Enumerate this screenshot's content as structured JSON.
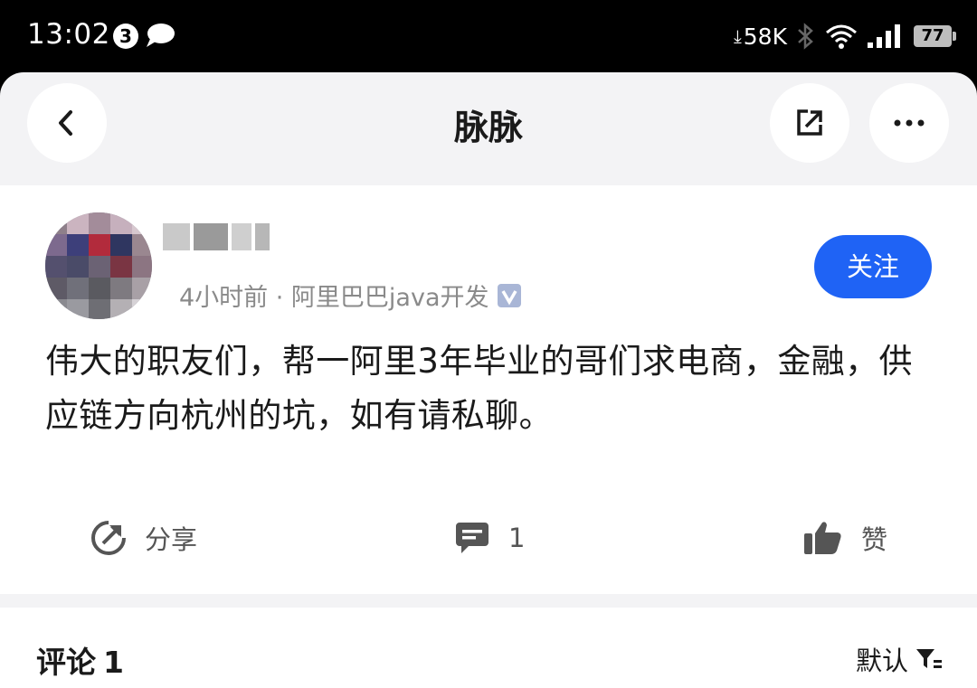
{
  "status_bar": {
    "time": "13:02",
    "notification_count": "3",
    "net_speed": "58K",
    "battery": "77"
  },
  "nav": {
    "title": "脉脉",
    "icons": [
      "back-icon",
      "share-out-icon",
      "more-icon"
    ]
  },
  "post": {
    "author_name": "",
    "meta": "4小时前 · 阿里巴巴java开发",
    "follow_label": "关注",
    "content": "伟大的职友们，帮一阿里3年毕业的哥们求电商，金融，供应链方向杭州的坑，如有请私聊。",
    "actions": {
      "share_label": "分享",
      "comment_count": "1",
      "like_label": "赞"
    }
  },
  "comments": {
    "title": "评论",
    "count": "1",
    "sort_label": "默认"
  },
  "colors": {
    "accent": "#1f63f5",
    "page_bg": "#f3f3f5",
    "meta_text": "#8a8a8a"
  }
}
